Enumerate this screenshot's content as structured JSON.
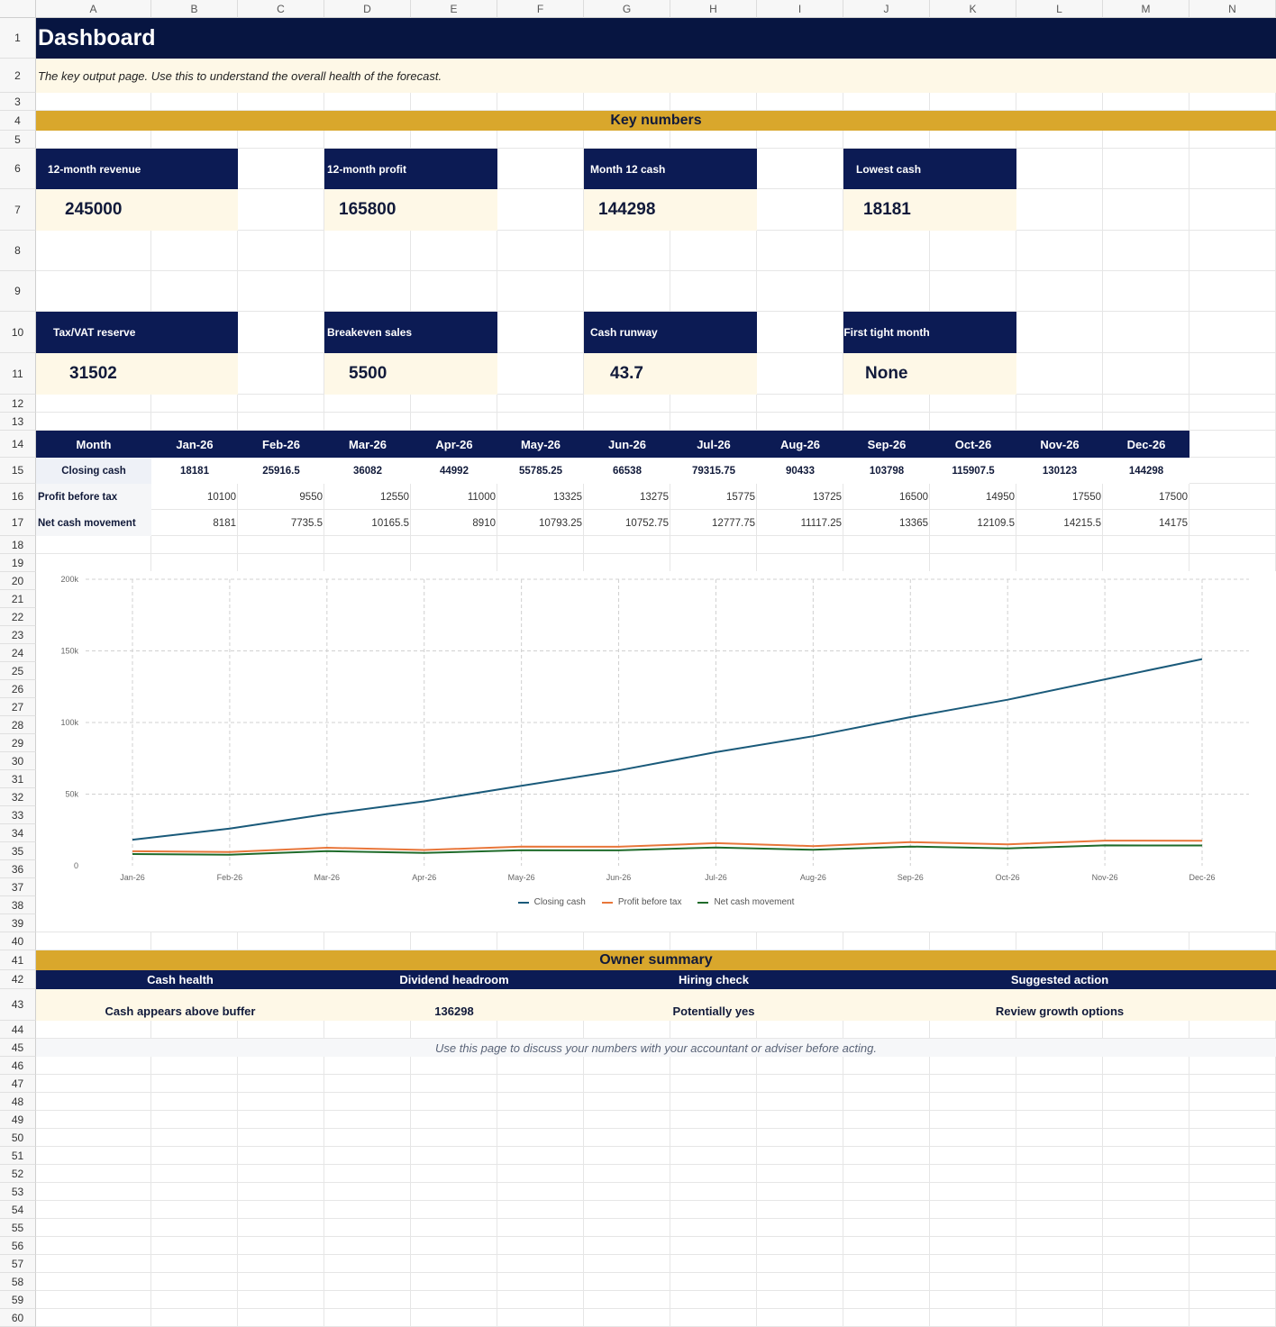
{
  "columns": [
    "A",
    "B",
    "C",
    "D",
    "E",
    "F",
    "G",
    "H",
    "I",
    "J",
    "K",
    "L",
    "M",
    "N"
  ],
  "rows": [
    "1",
    "2",
    "3",
    "4",
    "5",
    "6",
    "7",
    "8",
    "9",
    "10",
    "11",
    "12",
    "13",
    "14",
    "15",
    "16",
    "17",
    "18",
    "19",
    "20",
    "21",
    "22",
    "23",
    "24",
    "25",
    "26",
    "27",
    "28",
    "29",
    "30",
    "31",
    "32",
    "33",
    "34",
    "35",
    "36",
    "37",
    "38",
    "39",
    "40",
    "41",
    "42",
    "43",
    "44",
    "45",
    "46",
    "47",
    "48",
    "49",
    "50",
    "51",
    "52",
    "53",
    "54",
    "55",
    "56",
    "57",
    "58",
    "59",
    "60"
  ],
  "header": {
    "title": "Dashboard",
    "subtitle": "The key output page. Use this to understand the overall health of the forecast."
  },
  "key_numbers": {
    "heading": "Key numbers",
    "kpis": [
      {
        "label": "12-month revenue",
        "value": "245000"
      },
      {
        "label": "12-month profit",
        "value": "165800"
      },
      {
        "label": "Month 12 cash",
        "value": "144298"
      },
      {
        "label": "Lowest cash",
        "value": "18181"
      },
      {
        "label": "Tax/VAT reserve",
        "value": "31502"
      },
      {
        "label": "Breakeven sales",
        "value": "5500"
      },
      {
        "label": "Cash runway",
        "value": "43.7"
      },
      {
        "label": "First tight month",
        "value": "None"
      }
    ]
  },
  "table": {
    "header_label": "Month",
    "months": [
      "Jan-26",
      "Feb-26",
      "Mar-26",
      "Apr-26",
      "May-26",
      "Jun-26",
      "Jul-26",
      "Aug-26",
      "Sep-26",
      "Oct-26",
      "Nov-26",
      "Dec-26"
    ],
    "rows": [
      {
        "label": "Closing cash",
        "values": [
          "18181",
          "25916.5",
          "36082",
          "44992",
          "55785.25",
          "66538",
          "79315.75",
          "90433",
          "103798",
          "115907.5",
          "130123",
          "144298"
        ]
      },
      {
        "label": "Profit before tax",
        "values": [
          "10100",
          "9550",
          "12550",
          "11000",
          "13325",
          "13275",
          "15775",
          "13725",
          "16500",
          "14950",
          "17550",
          "17500"
        ]
      },
      {
        "label": "Net cash movement",
        "values": [
          "8181",
          "7735.5",
          "10165.5",
          "8910",
          "10793.25",
          "10752.75",
          "12777.75",
          "11117.25",
          "13365",
          "12109.5",
          "14215.5",
          "14175"
        ]
      }
    ]
  },
  "chart_data": {
    "type": "line",
    "title": "",
    "xlabel": "",
    "ylabel": "",
    "categories": [
      "Jan-26",
      "Feb-26",
      "Mar-26",
      "Apr-26",
      "May-26",
      "Jun-26",
      "Jul-26",
      "Aug-26",
      "Sep-26",
      "Oct-26",
      "Nov-26",
      "Dec-26"
    ],
    "ylim": [
      0,
      200000
    ],
    "yticks": [
      0,
      50000,
      100000,
      150000,
      200000
    ],
    "ytick_labels": [
      "0",
      "50k",
      "100k",
      "150k",
      "200k"
    ],
    "grid": true,
    "legend": "bottom",
    "series": [
      {
        "name": "Closing cash",
        "color": "#1a5a7a",
        "values": [
          18181,
          25916.5,
          36082,
          44992,
          55785.25,
          66538,
          79315.75,
          90433,
          103798,
          115907.5,
          130123,
          144298
        ]
      },
      {
        "name": "Profit before tax",
        "color": "#e8763a",
        "values": [
          10100,
          9550,
          12550,
          11000,
          13325,
          13275,
          15775,
          13725,
          16500,
          14950,
          17550,
          17500
        ]
      },
      {
        "name": "Net cash movement",
        "color": "#1f6b2a",
        "values": [
          8181,
          7735.5,
          10165.5,
          8910,
          10793.25,
          10752.75,
          12777.75,
          11117.25,
          13365,
          12109.5,
          14215.5,
          14175
        ]
      }
    ]
  },
  "owner_summary": {
    "heading": "Owner summary",
    "items": [
      {
        "label": "Cash health",
        "value": "Cash appears above buffer"
      },
      {
        "label": "Dividend headroom",
        "value": "136298"
      },
      {
        "label": "Hiring check",
        "value": "Potentially yes"
      },
      {
        "label": "Suggested action",
        "value": "Review growth options"
      }
    ],
    "note": "Use this page to discuss your numbers with your accountant or adviser before acting."
  },
  "colors": {
    "navy": "#0c1b54",
    "gold": "#d9a72c",
    "cream": "#fef8e7",
    "title_bar": "#071541"
  }
}
